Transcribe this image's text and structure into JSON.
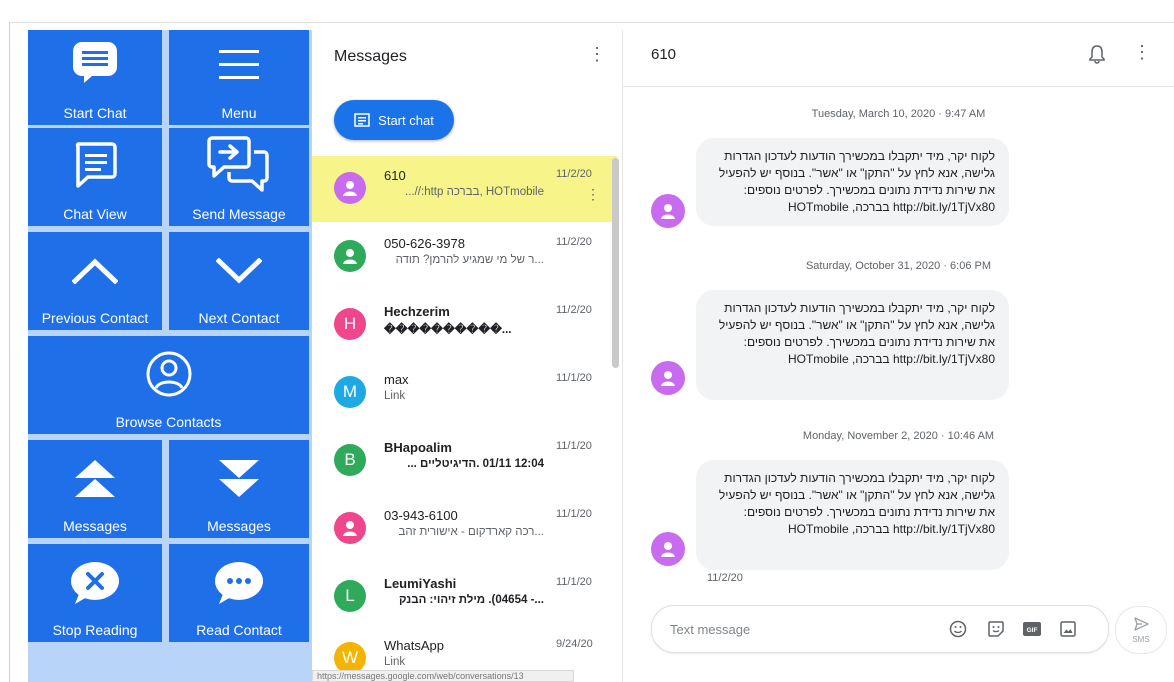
{
  "panel": {
    "tiles": [
      {
        "label": "Start Chat",
        "icon": "chat-bubble-icon"
      },
      {
        "label": "Menu",
        "icon": "hamburger-menu-icon"
      },
      {
        "label": "Chat View",
        "icon": "chat-view-icon"
      },
      {
        "label": "Send Message",
        "icon": "send-message-icon"
      },
      {
        "label": "Previous Contact",
        "icon": "chevron-up-icon"
      },
      {
        "label": "Next Contact",
        "icon": "chevron-down-icon"
      },
      {
        "label": "Browse Contacts",
        "icon": "person-circle-icon"
      },
      {
        "label": "Messages",
        "icon": "double-up-icon"
      },
      {
        "label": "Messages",
        "icon": "double-down-icon"
      },
      {
        "label": "Stop Reading",
        "icon": "stop-bubble-icon"
      },
      {
        "label": "Read Contact",
        "icon": "ellipsis-bubble-icon"
      }
    ]
  },
  "list": {
    "title": "Messages",
    "start_chat_label": "Start chat",
    "conversations": [
      {
        "name": "610",
        "snippet": "HOTmobile ,בברכה http://...",
        "date": "11/2/20",
        "initial": "",
        "color": "#c86bee"
      },
      {
        "name": "050-626-3978",
        "snippet": "...ר של מי שמגיע להרמן? תודה",
        "date": "11/2/20",
        "initial": "",
        "color": "#2eaa5a"
      },
      {
        "name": "Hechzerim",
        "snippet": "����������...",
        "date": "11/2/20",
        "initial": "H",
        "color": "#f0468c"
      },
      {
        "name": "max",
        "snippet": "Link",
        "date": "11/1/20",
        "initial": "M",
        "color": "#1ea9e6"
      },
      {
        "name": "BHapoalim",
        "snippet": "12:04 01/11 .הדיגיטליים ...",
        "date": "11/1/20",
        "initial": "B",
        "color": "#2eaa5a"
      },
      {
        "name": "03-943-6100",
        "snippet": "...רכה קארדקום - אישורית זהב",
        "date": "11/1/20",
        "initial": "",
        "color": "#f0468c"
      },
      {
        "name": "LeumiYashi",
        "snippet": "...- 04654). מילת זיהוי: הבנק",
        "date": "11/1/20",
        "initial": "L",
        "color": "#2eaa5a"
      },
      {
        "name": "WhatsApp",
        "snippet": "Link",
        "date": "9/24/20",
        "initial": "W",
        "color": "#f5b400"
      }
    ],
    "status_url": "https://messages.google.com/web/conversations/13"
  },
  "chat": {
    "title": "610",
    "dates": [
      "Tuesday, March 10, 2020 · 9:47 AM",
      "Saturday, October 31, 2020 · 6:06 PM",
      "Monday, November 2, 2020 · 10:46 AM"
    ],
    "messages": [
      "לקוח יקר, מיד יתקבלו במכשירך הודעות לעדכון הגדרות גלישה, אנא לחץ על \"התקן\" או \"אשר\". בנוסף יש להפעיל את שירות נדידת נתונים במכשירך. לפרטים נוספים: http://bit.ly/1TjVx80 בברכה, HOTmobile",
      "לקוח יקר, מיד יתקבלו במכשירך הודעות לעדכון הגדרות גלישה, אנא לחץ על \"התקן\" או \"אשר\". בנוסף יש להפעיל את שירות נדידת נתונים במכשירך. לפרטים נוספים: http://bit.ly/1TjVx80 בברכה, HOTmobile",
      "לקוח יקר, מיד יתקבלו במכשירך הודעות לעדכון הגדרות גלישה, אנא לחץ על \"התקן\" או \"אשר\". בנוסף יש להפעיל את שירות נדידת נתונים במכשירך. לפרטים נוספים: http://bit.ly/1TjVx80 בברכה, HOTmobile"
    ],
    "last_date": "11/2/20",
    "compose_placeholder": "Text message",
    "send_label": "SMS"
  }
}
